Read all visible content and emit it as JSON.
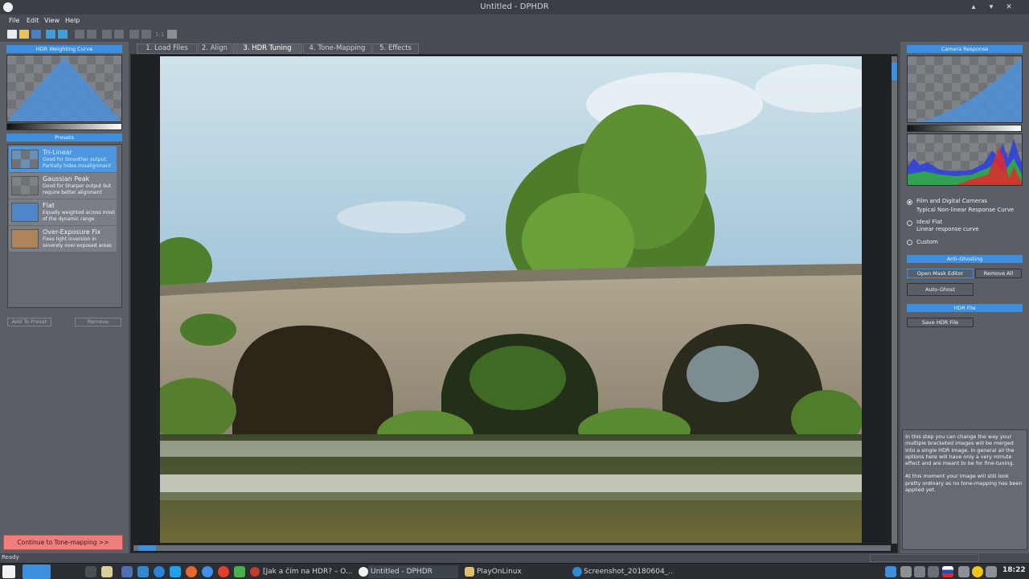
{
  "window": {
    "title": "Untitled - DPHDR",
    "buttons": [
      "▴",
      "▾",
      "✕"
    ]
  },
  "menu": [
    "File",
    "Edit",
    "View",
    "Help"
  ],
  "toolbar": {
    "zoom_label": "1:1"
  },
  "left": {
    "weighting_header": "HDR Weighting Curve",
    "presets_header": "Presets",
    "presets": [
      {
        "name": "Tri-Linear",
        "desc": "Good for Smoother output. Partially hides misalignment"
      },
      {
        "name": "Gaussian Peak",
        "desc": "Good for Sharper output but require better alignment"
      },
      {
        "name": "Flat",
        "desc": "Equally weighted across most of the dynamic range"
      },
      {
        "name": "Over-Exposure Fix",
        "desc": "Fixes light inversion in severely over-exposed areas"
      }
    ],
    "add_preset": "Add To Preset",
    "remove": "Remove",
    "continue": "Continue to Tone-mapping >>"
  },
  "tabs": [
    "1. Load Files",
    "2. Align",
    "3. HDR Tuning",
    "4. Tone-Mapping",
    "5. Effects"
  ],
  "active_tab": 2,
  "right": {
    "camera_header": "Camera Response",
    "options": [
      {
        "title": "Film and Digital Cameras",
        "sub": "Typical Non-linear Response Curve"
      },
      {
        "title": "Ideal Flat",
        "sub": "Linear response curve"
      },
      {
        "title": "Custom",
        "sub": ""
      }
    ],
    "selected_option": 0,
    "antighost_header": "Anti-Ghosting",
    "open_mask": "Open Mask Editor",
    "remove_all": "Remove All",
    "auto_ghost": "Auto-Ghost",
    "hdrfile_header": "HDR File",
    "save_hdr": "Save HDR File",
    "help_p1": "In this step you can change the way your multiple bracketed images will be merged into a single HDR image. In general all the options here will have only a very minute effect and are meant to be for fine-tuning.",
    "help_p2": "At this moment your image will still look pretty ordinary as no tone-mapping has been applied yet."
  },
  "status": {
    "text": "Ready"
  },
  "taskbar": {
    "tasks": [
      "[Jak a čím na HDR? – O...",
      "Untitled - DPHDR",
      "PlayOnLinux",
      "Screenshot_20180604_..."
    ],
    "clock": "18:22"
  }
}
